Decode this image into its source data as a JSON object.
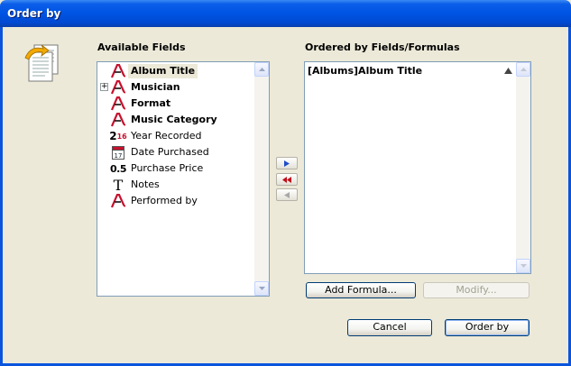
{
  "window": {
    "title": "Order by"
  },
  "available": {
    "heading": "Available Fields",
    "fields": [
      {
        "label": "Album Title",
        "icon": "alpha-field-icon",
        "bold": true,
        "selected": true
      },
      {
        "label": "Musician",
        "icon": "alpha-field-icon",
        "bold": true,
        "expandable": true
      },
      {
        "label": "Format",
        "icon": "alpha-field-icon",
        "bold": true
      },
      {
        "label": "Music Category",
        "icon": "alpha-field-icon",
        "bold": true
      },
      {
        "label": "Year Recorded",
        "icon": "integer-field-icon",
        "icon_text": "2",
        "icon_sup": "16"
      },
      {
        "label": "Date Purchased",
        "icon": "date-field-icon",
        "icon_text": "17"
      },
      {
        "label": "Purchase Price",
        "icon": "real-field-icon",
        "icon_text": "0.5"
      },
      {
        "label": "Notes",
        "icon": "text-field-icon",
        "icon_text": "T"
      },
      {
        "label": "Performed by",
        "icon": "alpha-field-icon"
      }
    ]
  },
  "ordered": {
    "heading": "Ordered by Fields/Formulas",
    "items": [
      {
        "label": "[Albums]Album Title",
        "direction": "ascending"
      }
    ]
  },
  "buttons": {
    "add_formula": "Add Formula...",
    "modify": "Modify...",
    "cancel": "Cancel",
    "order_by": "Order by"
  },
  "colors": {
    "accent": "#0054e3",
    "field_icon_red": "#c8102e",
    "arrow_blue": "#1d4ec8",
    "arrow_red": "#c0101c"
  }
}
